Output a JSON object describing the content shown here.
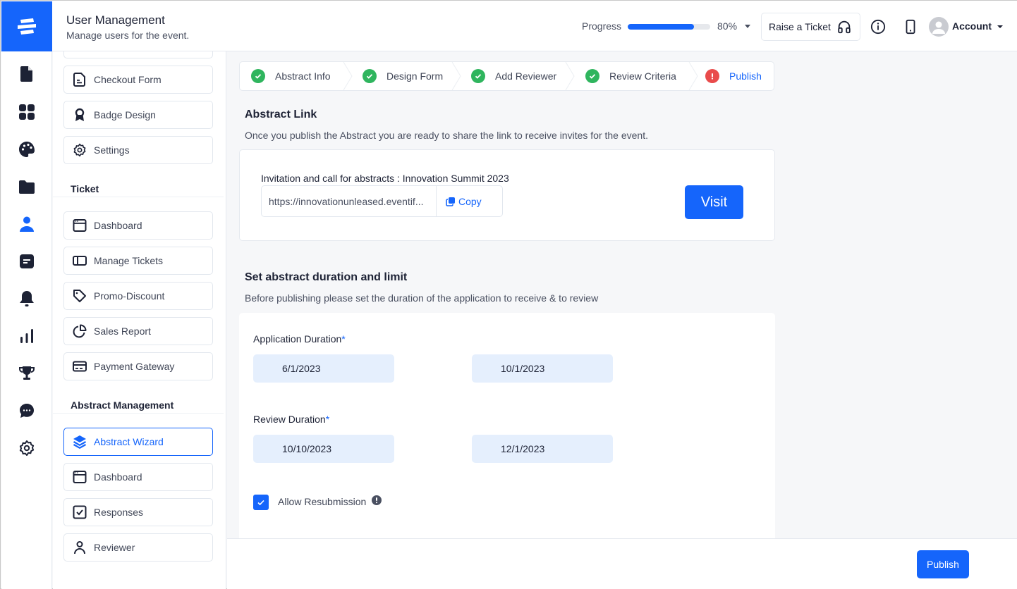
{
  "header": {
    "title": "User Management",
    "subtitle": "Manage users for the event.",
    "progress_label": "Progress",
    "progress_percent": 80,
    "progress_value_text": "80%",
    "raise_ticket_label": "Raise a Ticket",
    "account_label": "Account"
  },
  "rail": {
    "icons": [
      "document-icon",
      "grid-icon",
      "palette-icon",
      "folder-icon",
      "user-icon",
      "message-square-icon",
      "bell-icon",
      "bar-chart-icon",
      "trophy-icon",
      "chat-bubble-icon",
      "settings-icon"
    ],
    "active_icon": "user-icon"
  },
  "subnav": {
    "top_items": [
      {
        "label": "Checkout Form",
        "icon": "file-text-icon"
      },
      {
        "label": "Badge Design",
        "icon": "badge-icon"
      },
      {
        "label": "Settings",
        "icon": "settings-icon"
      }
    ],
    "ticket_section": {
      "title": "Ticket",
      "items": [
        {
          "label": "Dashboard",
          "icon": "browser-window-icon"
        },
        {
          "label": "Manage Tickets",
          "icon": "ticket-panel-icon"
        },
        {
          "label": "Promo-Discount",
          "icon": "tag-icon"
        },
        {
          "label": "Sales Report",
          "icon": "pie-chart-icon"
        },
        {
          "label": "Payment Gateway",
          "icon": "credit-card-icon"
        }
      ]
    },
    "abstract_section": {
      "title": "Abstract Management",
      "items": [
        {
          "label": "Abstract Wizard",
          "icon": "layers-icon",
          "active": true
        },
        {
          "label": "Dashboard",
          "icon": "browser-window-icon"
        },
        {
          "label": "Responses",
          "icon": "checkbox-icon"
        },
        {
          "label": "Reviewer",
          "icon": "person-icon"
        }
      ]
    }
  },
  "stepper": {
    "steps": [
      {
        "label": "Abstract Info",
        "status": "complete"
      },
      {
        "label": "Design Form",
        "status": "complete"
      },
      {
        "label": "Add Reviewer",
        "status": "complete"
      },
      {
        "label": "Review Criteria",
        "status": "complete"
      },
      {
        "label": "Publish",
        "status": "error"
      }
    ]
  },
  "abstract_link": {
    "title": "Abstract Link",
    "description": "Once you publish the Abstract you are ready to share the link to receive invites for the event.",
    "invitation_title": "Invitation and call for abstracts : Innovation Summit 2023",
    "url": "https://innovationunleased.eventif...",
    "copy_label": "Copy",
    "visit_label": "Visit"
  },
  "duration": {
    "title": "Set abstract duration and limit",
    "description": "Before publishing please set the duration of the application to receive & to review",
    "application_label": "Application Duration",
    "application_start": "6/1/2023",
    "application_end": "10/1/2023",
    "review_label": "Review Duration",
    "review_start": "10/10/2023",
    "review_end": "12/1/2023",
    "required_marker": "*",
    "allow_resubmission_label": "Allow Resubmission",
    "allow_resubmission_checked": true
  },
  "footer": {
    "publish_label": "Publish"
  },
  "colors": {
    "accent": "#1565fb",
    "success": "#2fb55e",
    "error": "#e94b4b",
    "text_dark": "#1d2235",
    "date_bg": "#e5effd"
  }
}
